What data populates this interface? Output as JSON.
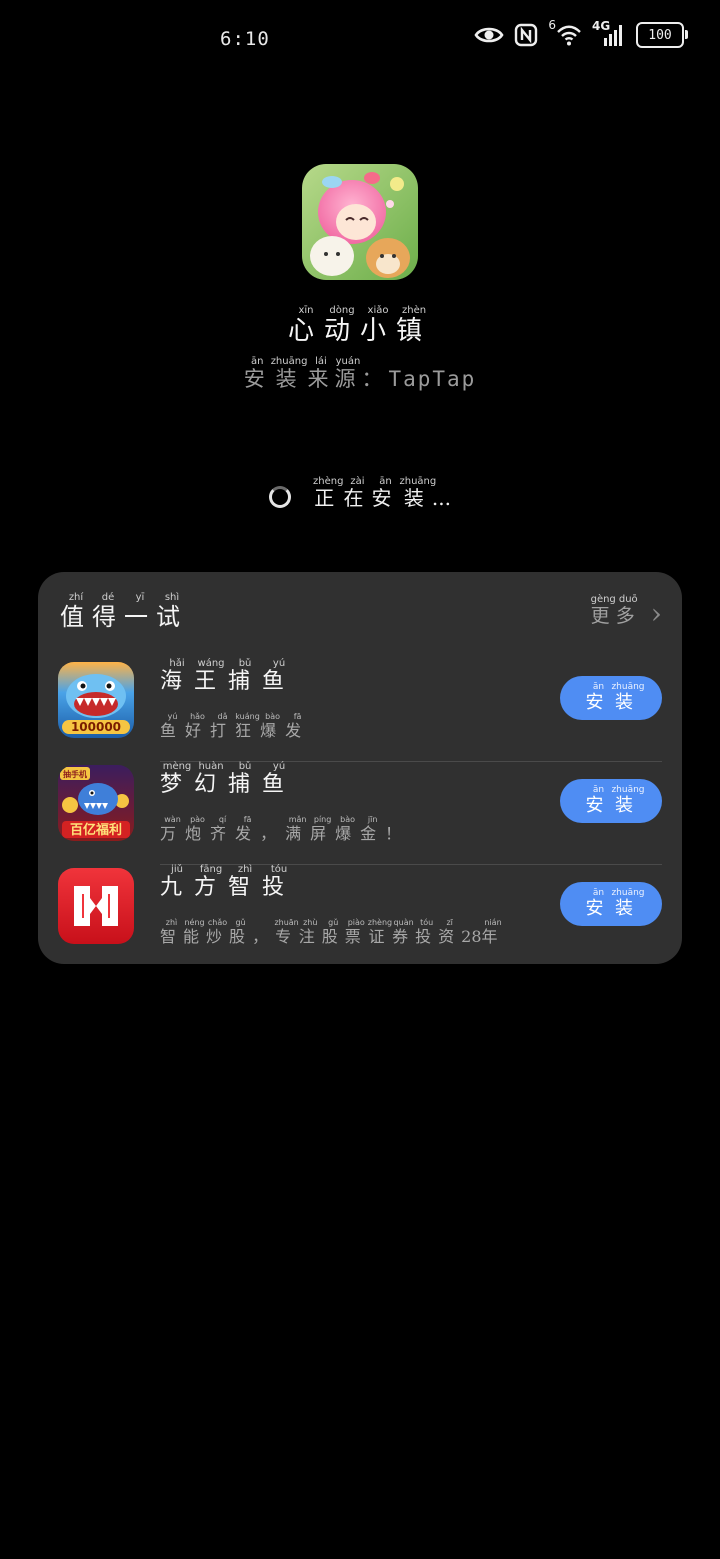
{
  "status_bar": {
    "time": "6:10",
    "signal_badge": "6",
    "network": "4G",
    "battery": "100",
    "icons": [
      "eye-icon",
      "nfc-icon",
      "wifi-icon",
      "cellular-signal-icon",
      "battery-icon"
    ]
  },
  "app": {
    "name": "心动小镇",
    "name_pinyin": [
      "xīn",
      "dòng",
      "xiǎo",
      "zhèn"
    ],
    "source_prefix": "安装来源",
    "source_prefix_pinyin": [
      "ān",
      "zhuāng",
      "lái",
      "yuán"
    ],
    "source_separator": "：",
    "source_value": "TapTap",
    "status": "正在安装...",
    "status_pinyin": [
      "zhèng",
      "zài",
      "ān",
      "zhuāng"
    ]
  },
  "recommend": {
    "title": "值得一试",
    "title_pinyin": [
      "zhí",
      "dé",
      "yī",
      "shì"
    ],
    "more_label": "更多",
    "more_pinyin": [
      "gèng",
      "duō"
    ],
    "install_label": "安装",
    "install_pinyin": [
      "ān",
      "zhuāng"
    ],
    "apps": [
      {
        "name": "海王捕鱼",
        "name_pinyin": [
          "hǎi",
          "wáng",
          "bǔ",
          "yú"
        ],
        "desc": "鱼好打狂爆发",
        "desc_pinyin": [
          "yú",
          "hǎo",
          "dǎ",
          "kuáng",
          "bào",
          "fā"
        ],
        "icon": "shark-fishing-game-icon",
        "icon_text": "100000"
      },
      {
        "name": "梦幻捕鱼",
        "name_pinyin": [
          "mèng",
          "huàn",
          "bǔ",
          "yú"
        ],
        "desc": "万炮齐发，满屏爆金！",
        "desc_pinyin": [
          "wàn",
          "pào",
          "qí",
          "fā",
          "",
          "mǎn",
          "píng",
          "bào",
          "jīn",
          ""
        ],
        "icon": "dream-fishing-game-icon",
        "icon_text": "百亿福利",
        "icon_badge": "抽手机"
      },
      {
        "name": "九方智投",
        "name_pinyin": [
          "jiǔ",
          "fāng",
          "zhì",
          "tóu"
        ],
        "desc": "智能炒股，专注股票证券投资28年",
        "desc_pinyin": [
          "zhì",
          "néng",
          "chǎo",
          "gǔ",
          "",
          "zhuān",
          "zhù",
          "gǔ",
          "piào",
          "zhèng",
          "quàn",
          "tóu",
          "zī",
          "",
          "",
          "nián"
        ],
        "icon": "jiufang-finance-icon"
      }
    ]
  }
}
